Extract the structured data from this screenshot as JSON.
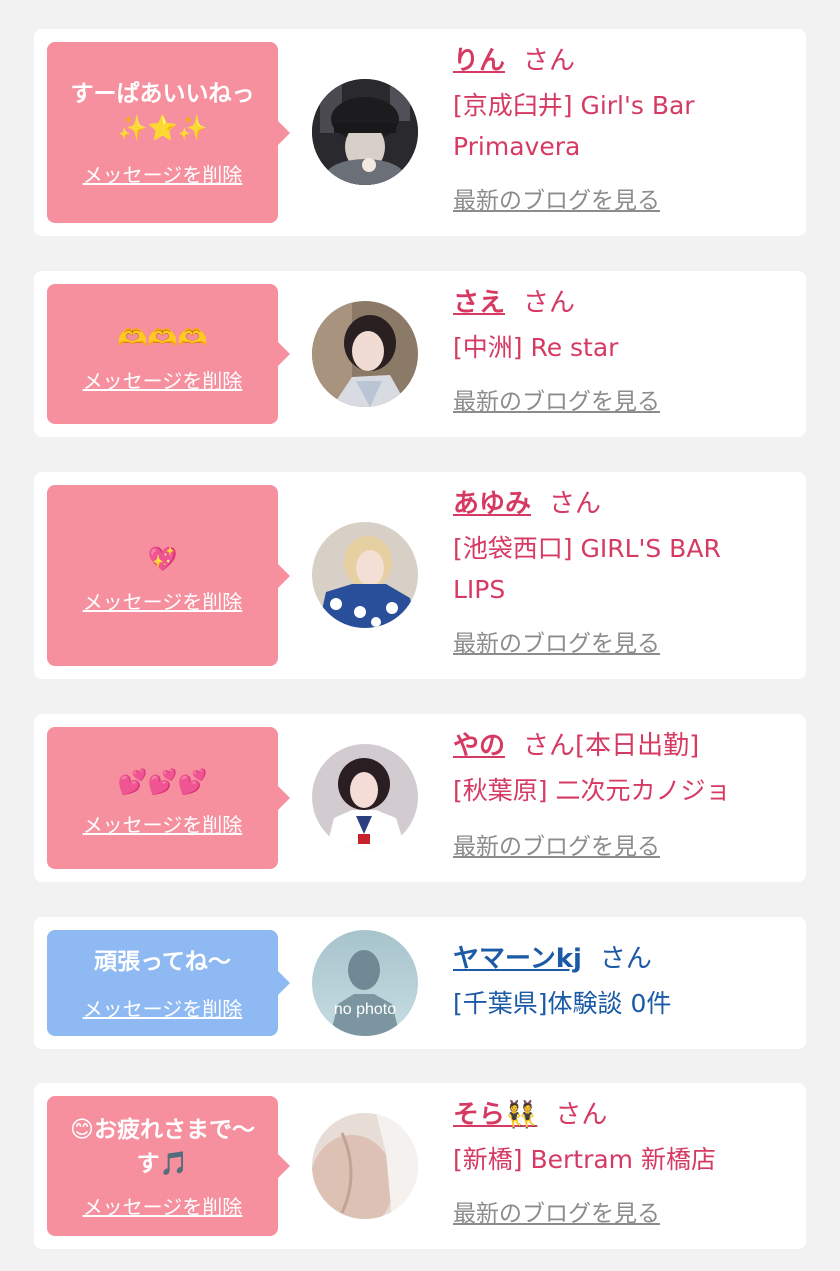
{
  "delete_label": "メッセージを削除",
  "blog_label": "最新のブログを見る",
  "honorific": "さん",
  "no_photo_text": "no photo",
  "cards": [
    {
      "message": "すーぱあいいねっ",
      "emoji": "✨⭐✨",
      "name": "りん",
      "suffix": "",
      "shop_lines": [
        "[京成臼井] Girl's Bar",
        "Primavera"
      ],
      "theme": "pink"
    },
    {
      "message": "",
      "emoji": "🫶🫶🫶",
      "name": "さえ",
      "suffix": "",
      "shop_lines": [
        "[中洲] Re star"
      ],
      "theme": "pink"
    },
    {
      "message": "",
      "emoji": "💖",
      "name": "あゆみ",
      "suffix": "",
      "shop_lines": [
        "[池袋西口] GIRL'S BAR",
        "LIPS"
      ],
      "theme": "pink"
    },
    {
      "message": "",
      "emoji": "💕💕💕",
      "name": "やの",
      "suffix": "[本日出勤]",
      "shop_lines": [
        "[秋葉原] 二次元カノジョ"
      ],
      "theme": "pink"
    },
    {
      "message": "頑張ってね〜",
      "emoji": "",
      "name": "ヤマーンkj",
      "suffix": "",
      "shop_lines": [
        "[千葉県]体験談 0件"
      ],
      "theme": "blue"
    },
    {
      "message": "😊お疲れさまで〜",
      "message2": "す🎵",
      "name": "そら👯",
      "suffix": "",
      "shop_lines": [
        "[新橋] Bertram 新橋店"
      ],
      "theme": "pink"
    }
  ]
}
